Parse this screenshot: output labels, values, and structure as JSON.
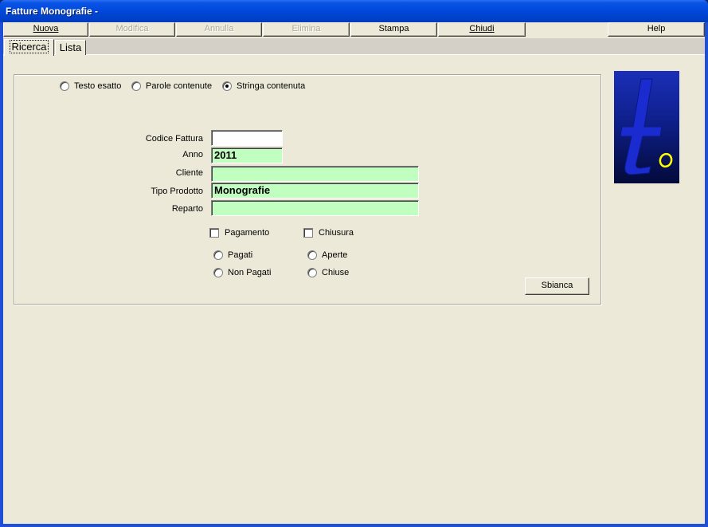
{
  "window": {
    "title": "Fatture Monografie -"
  },
  "toolbar": {
    "nuova": "Nuova",
    "modifica": "Modifica",
    "annulla": "Annulla",
    "elimina": "Elimina",
    "stampa": "Stampa",
    "chiudi": "Chiudi",
    "help": "Help"
  },
  "tabs": {
    "ricerca": "Ricerca",
    "lista": "Lista"
  },
  "search_mode": {
    "options": [
      "Testo esatto",
      "Parole contenute",
      "Stringa contenuta"
    ],
    "selected": "Stringa contenuta"
  },
  "form": {
    "codice_fattura": {
      "label": "Codice Fattura",
      "value": ""
    },
    "anno": {
      "label": "Anno",
      "value": "2011"
    },
    "cliente": {
      "label": "Cliente",
      "value": ""
    },
    "tipo_prodotto": {
      "label": "Tipo Prodotto",
      "value": "Monografie"
    },
    "reparto": {
      "label": "Reparto",
      "value": ""
    }
  },
  "filters": {
    "pagamento": {
      "label": "Pagamento",
      "checked": false
    },
    "chiusura": {
      "label": "Chiusura",
      "checked": false
    },
    "pagati": "Pagati",
    "non_pagati": "Non Pagati",
    "aperte": "Aperte",
    "chiuse": "Chiuse"
  },
  "buttons": {
    "sbianca": "Sbianca"
  },
  "colors": {
    "field_green": "#c0ffc0",
    "logo_letter": "#1a2bd0",
    "logo_accent": "#ffff00"
  },
  "logo": {
    "name": "to-logo-icon"
  }
}
